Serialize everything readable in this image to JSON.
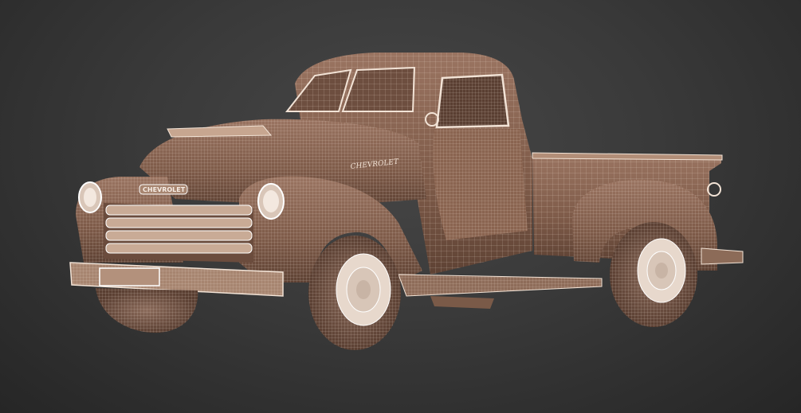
{
  "scene": {
    "subject": "truck-wireframe",
    "grille_badge_text": "CHEVROLET",
    "hood_script_text": "CHEVROLET",
    "plate_text": "",
    "colors": {
      "body_fill": "#86624e",
      "body_dark": "#5e4234",
      "wire": "#f2e3d6",
      "tire": "#6b4d3e",
      "hub": "#e7d8cc"
    }
  }
}
